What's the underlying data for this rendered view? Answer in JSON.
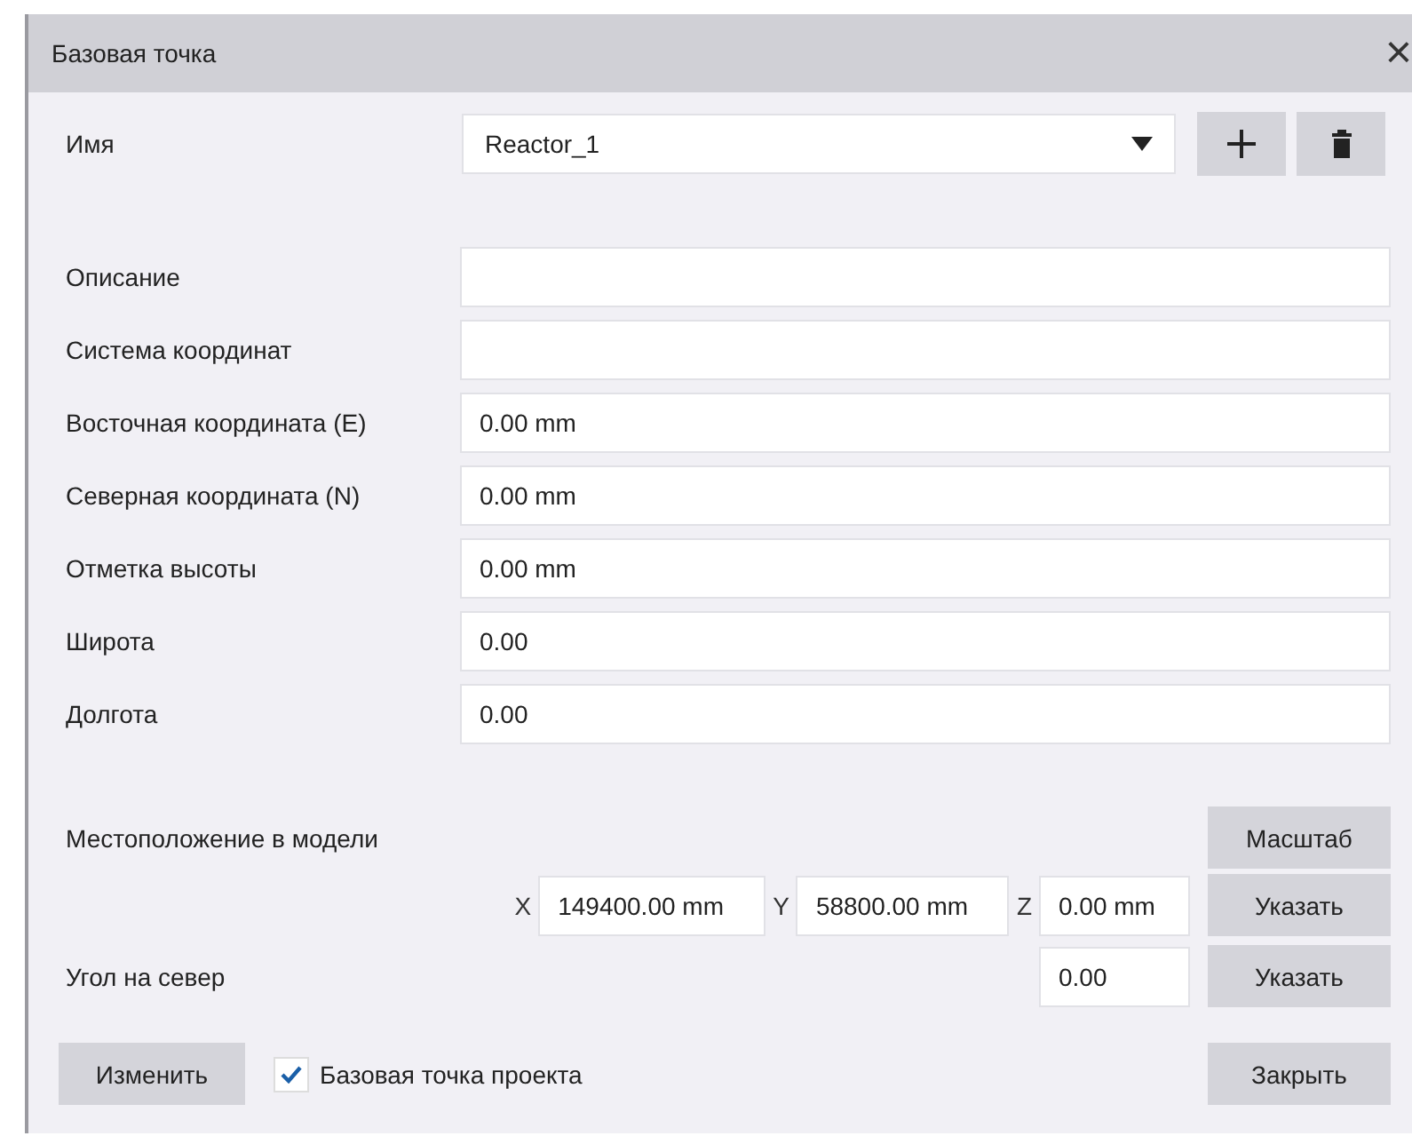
{
  "window": {
    "title": "Базовая точка",
    "close": "×"
  },
  "name_row": {
    "label": "Имя",
    "value": "Reactor_1"
  },
  "fields": [
    {
      "label": "Описание"
    },
    {
      "label": "Система координат"
    },
    {
      "label": "Восточная координата  (E)",
      "value": "0.00 mm"
    },
    {
      "label": "Северная координата  (N)",
      "value": "0.00 mm"
    },
    {
      "label": "Отметка высоты",
      "value": "0.00 mm"
    },
    {
      "label": "Широта",
      "value": "0.00"
    },
    {
      "label": "Долгота",
      "value": "0.00"
    }
  ],
  "model_location": {
    "label": "Местоположение в модели",
    "scale_button": "Масштаб",
    "coords": [
      {
        "axis": "X",
        "value": "149400.00 mm"
      },
      {
        "axis": "Y",
        "value": "58800.00 mm"
      },
      {
        "axis": "Z",
        "value": "0.00 mm"
      }
    ],
    "pick_button": "Указать"
  },
  "north_angle": {
    "label": "Угол на север",
    "value": "0.00",
    "pick_button": "Указать"
  },
  "footer": {
    "edit_button": "Изменить",
    "project_base_point": {
      "label": "Базовая точка проекта",
      "checked": true
    },
    "close_button": "Закрыть"
  }
}
